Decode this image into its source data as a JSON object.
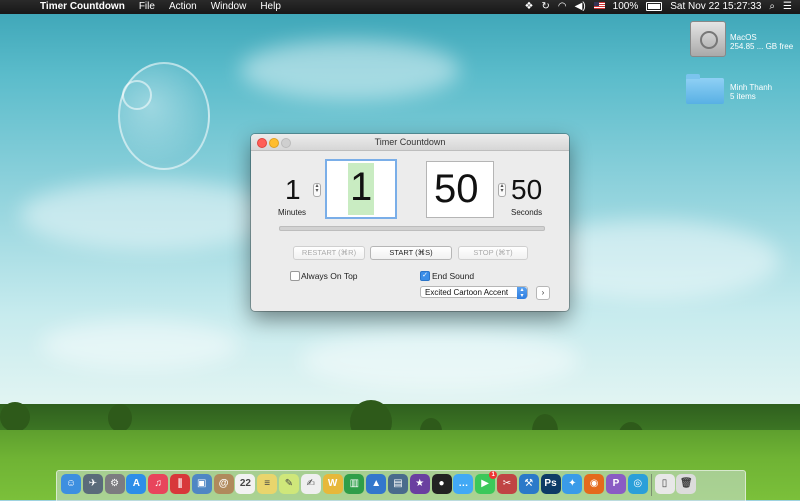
{
  "menubar": {
    "app_name": "Timer Countdown",
    "menus": [
      "File",
      "Action",
      "Window",
      "Help"
    ],
    "battery": "100%",
    "datetime": "Sat Nov 22  15:27:33"
  },
  "desktop": {
    "drive": {
      "name": "MacOS",
      "info": "254.85 ... GB free"
    },
    "folder": {
      "name": "Minh Thanh",
      "info": "5 items"
    }
  },
  "window": {
    "title": "Timer Countdown",
    "current_minutes": "1",
    "current_seconds": "50",
    "minutes_field": "1",
    "seconds_field": "50",
    "minutes_label": "Minutes",
    "seconds_label": "Seconds",
    "progress": 0,
    "restart_label": "RESTART (⌘R)",
    "start_label": "START (⌘S)",
    "stop_label": "STOP (⌘T)",
    "always_on_top_label": "Always On Top",
    "always_on_top_checked": false,
    "end_sound_label": "End Sound",
    "end_sound_checked": true,
    "sound_selected": "Excited Cartoon Accent",
    "play_button": "›"
  },
  "dock": {
    "items": [
      {
        "name": "finder-icon",
        "glyph": "☺",
        "color": "#3d8fe0"
      },
      {
        "name": "launchpad-icon",
        "glyph": "✈",
        "color": "#5a6b7a"
      },
      {
        "name": "system-preferences-icon",
        "glyph": "⚙",
        "color": "#7c7c80"
      },
      {
        "name": "app-store-icon",
        "glyph": "A",
        "color": "#2d8ee8"
      },
      {
        "name": "itunes-icon",
        "glyph": "♫",
        "color": "#e8455c"
      },
      {
        "name": "parallels-icon",
        "glyph": "∥",
        "color": "#d8383a"
      },
      {
        "name": "preview-icon",
        "glyph": "▣",
        "color": "#4f87c4"
      },
      {
        "name": "contacts-icon",
        "glyph": "@",
        "color": "#b08a5c"
      },
      {
        "name": "calendar-icon",
        "glyph": "22",
        "color": "#f2f2f2"
      },
      {
        "name": "notes-icon",
        "glyph": "≡",
        "color": "#e9d56c"
      },
      {
        "name": "stickies-icon",
        "glyph": "✎",
        "color": "#cfe77a"
      },
      {
        "name": "textedit-icon",
        "glyph": "✍",
        "color": "#efefef"
      },
      {
        "name": "wunderlist-icon",
        "glyph": "W",
        "color": "#e7b83a"
      },
      {
        "name": "numbers-icon",
        "glyph": "▥",
        "color": "#2f9e49"
      },
      {
        "name": "keynote-icon",
        "glyph": "▲",
        "color": "#3377cc"
      },
      {
        "name": "screen-icon",
        "glyph": "▤",
        "color": "#4a6b8c"
      },
      {
        "name": "imovie-icon",
        "glyph": "★",
        "color": "#6a3fa0"
      },
      {
        "name": "dvd-player-icon",
        "glyph": "●",
        "color": "#222"
      },
      {
        "name": "messages-icon",
        "glyph": "…",
        "color": "#42a9f5"
      },
      {
        "name": "facetime-icon",
        "glyph": "▶",
        "color": "#3cc85a",
        "badge": "1"
      },
      {
        "name": "tool-icon",
        "glyph": "✂",
        "color": "#c04444"
      },
      {
        "name": "xcode-icon",
        "glyph": "⚒",
        "color": "#2b79c9"
      },
      {
        "name": "photoshop-icon",
        "glyph": "Ps",
        "color": "#0d3b66"
      },
      {
        "name": "safari-icon",
        "glyph": "✦",
        "color": "#3a9be8"
      },
      {
        "name": "firefox-icon",
        "glyph": "◉",
        "color": "#e46a1c"
      },
      {
        "name": "podcast-icon",
        "glyph": "P",
        "color": "#8a5cc4"
      },
      {
        "name": "instastats-icon",
        "glyph": "◎",
        "color": "#2b9fd9"
      },
      {
        "name": "document-icon",
        "glyph": "▯",
        "color": "#e8e8e8"
      },
      {
        "name": "trash-icon",
        "glyph": "🗑",
        "color": "#dcdcdc"
      }
    ]
  }
}
